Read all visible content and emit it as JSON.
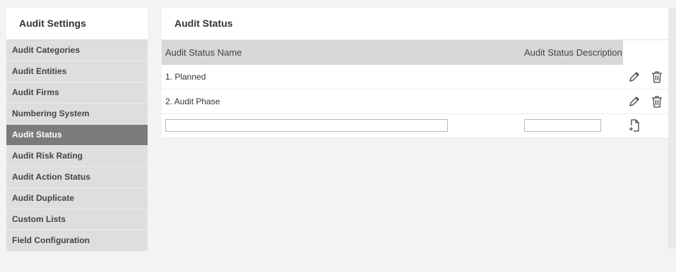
{
  "sidebar": {
    "title": "Audit Settings",
    "items": [
      {
        "label": "Audit Categories",
        "active": false
      },
      {
        "label": "Audit Entities",
        "active": false
      },
      {
        "label": "Audit Firms",
        "active": false
      },
      {
        "label": "Numbering System",
        "active": false
      },
      {
        "label": "Audit Status",
        "active": true
      },
      {
        "label": "Audit Risk Rating",
        "active": false
      },
      {
        "label": "Audit Action Status",
        "active": false
      },
      {
        "label": "Audit Duplicate",
        "active": false
      },
      {
        "label": "Custom Lists",
        "active": false
      },
      {
        "label": "Field Configuration",
        "active": false
      }
    ]
  },
  "main": {
    "title": "Audit Status",
    "columns": {
      "name": "Audit Status Name",
      "description": "Audit Status Description"
    },
    "rows": [
      {
        "name": "1. Planned",
        "description": ""
      },
      {
        "name": "2. Audit Phase",
        "description": ""
      }
    ],
    "new_row": {
      "name_value": "",
      "description_value": ""
    }
  },
  "icons": {
    "edit": "pencil-icon",
    "delete": "trash-icon",
    "add": "add-file-icon"
  },
  "colors": {
    "active_item_bg": "#7b7b7b",
    "sidebar_item_bg": "#dedede",
    "table_header_bg": "#d7d7d7"
  }
}
